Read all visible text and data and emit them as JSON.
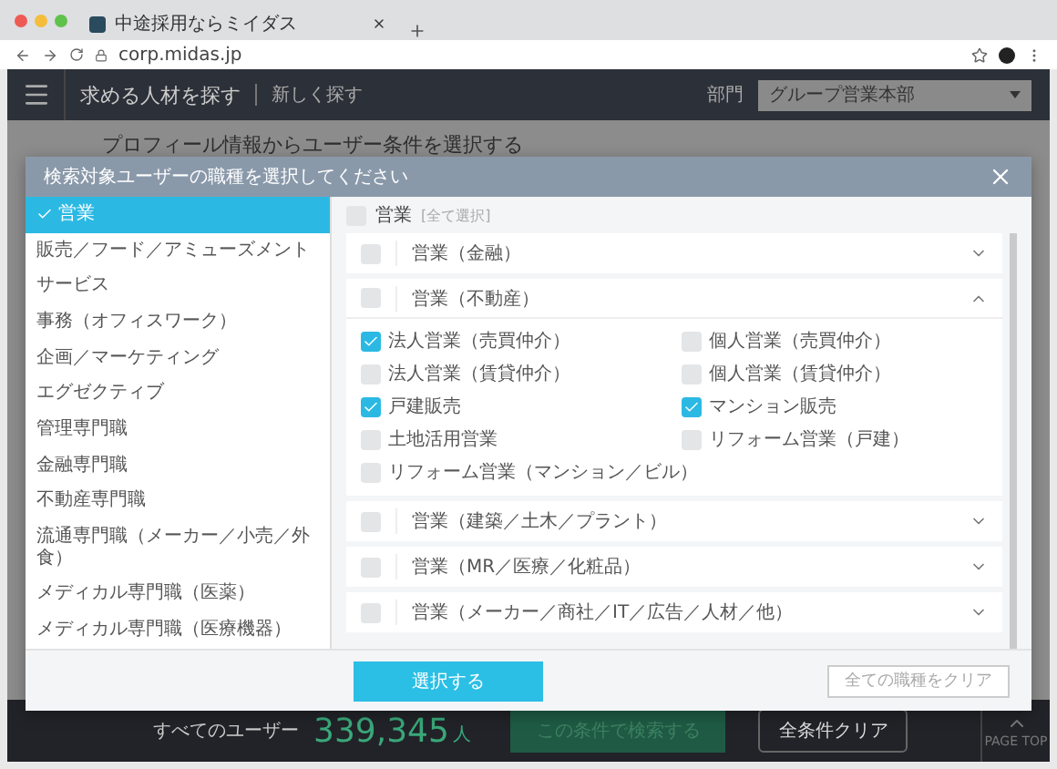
{
  "browser": {
    "tab_title": "中途採用ならミイダス",
    "url": "corp.midas.jp"
  },
  "header": {
    "title": "求める人材を探す",
    "new_search": "新しく探す",
    "department_label": "部門",
    "department_value": "グループ営業本部"
  },
  "page_title": "プロフィール情報からユーザー条件を選択する",
  "modal": {
    "title": "検索対象ユーザーの職種を選択してください",
    "categories": [
      {
        "label": "営業",
        "selected": true
      },
      {
        "label": "販売／フード／アミューズメント",
        "selected": false
      },
      {
        "label": "サービス",
        "selected": false
      },
      {
        "label": "事務（オフィスワーク）",
        "selected": false
      },
      {
        "label": "企画／マーケティング",
        "selected": false
      },
      {
        "label": "エグゼクティブ",
        "selected": false
      },
      {
        "label": "管理専門職",
        "selected": false
      },
      {
        "label": "金融専門職",
        "selected": false
      },
      {
        "label": "不動産専門職",
        "selected": false
      },
      {
        "label": "流通専門職（メーカー／小売／外食）",
        "selected": false
      },
      {
        "label": "メディカル専門職（医薬）",
        "selected": false
      },
      {
        "label": "メディカル専門職（医療機器）",
        "selected": false
      }
    ],
    "group": {
      "label": "営業",
      "select_all": "[全て選択]",
      "checked": false
    },
    "subcategories": [
      {
        "label": "営業（金融）",
        "checked": false,
        "expanded": false
      },
      {
        "label": "営業（不動産）",
        "checked": false,
        "expanded": true,
        "options": [
          {
            "label": "法人営業（売買仲介）",
            "checked": true
          },
          {
            "label": "個人営業（売買仲介）",
            "checked": false
          },
          {
            "label": "法人営業（賃貸仲介）",
            "checked": false
          },
          {
            "label": "個人営業（賃貸仲介）",
            "checked": false
          },
          {
            "label": "戸建販売",
            "checked": true
          },
          {
            "label": "マンション販売",
            "checked": true
          },
          {
            "label": "土地活用営業",
            "checked": false
          },
          {
            "label": "リフォーム営業（戸建）",
            "checked": false
          },
          {
            "label": "リフォーム営業（マンション／ビル）",
            "checked": false
          }
        ]
      },
      {
        "label": "営業（建築／土木／プラント）",
        "checked": false,
        "expanded": false
      },
      {
        "label": "営業（MR／医療／化粧品）",
        "checked": false,
        "expanded": false
      },
      {
        "label": "営業（メーカー／商社／IT／広告／人材／他）",
        "checked": false,
        "expanded": false
      }
    ],
    "submit_button": "選択する",
    "clear_button": "全ての職種をクリア"
  },
  "bottom_bar": {
    "label": "すべてのユーザー",
    "count": "339,345",
    "unit": "人",
    "search_button": "この条件で検索する",
    "clear_button": "全条件クリア",
    "page_top": "PAGE TOP"
  }
}
